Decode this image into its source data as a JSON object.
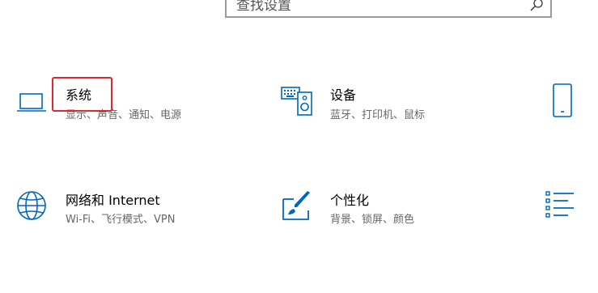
{
  "search": {
    "placeholder": "查找设置",
    "icon": "search-icon"
  },
  "accent_color": "#0067c0",
  "highlight_color": "#e0282e",
  "tiles": [
    {
      "title": "系统",
      "subtitle": "显示、声音、通知、电源",
      "icon": "laptop-icon"
    },
    {
      "title": "设备",
      "subtitle": "蓝牙、打印机、鼠标",
      "icon": "keyboard-speaker-icon"
    },
    {
      "title": "",
      "subtitle": "",
      "icon": "phone-icon"
    },
    {
      "title": "网络和 Internet",
      "subtitle": "Wi-Fi、飞行模式、VPN",
      "icon": "globe-icon"
    },
    {
      "title": "个性化",
      "subtitle": "背景、锁屏、颜色",
      "icon": "paintbrush-icon"
    },
    {
      "title": "",
      "subtitle": "",
      "icon": "apps-list-icon"
    }
  ]
}
